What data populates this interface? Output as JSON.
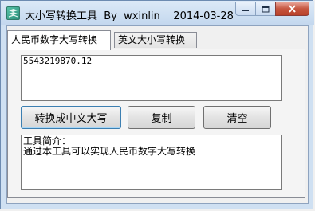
{
  "window": {
    "title": "大小写转换工具  By  wxinlin    2014-03-28",
    "app_icon": "converter-app-icon",
    "controls": {
      "minimize_icon": "minimize-icon",
      "maximize_icon": "maximize-icon",
      "close_icon": "close-icon"
    }
  },
  "tabs": [
    {
      "label": "人民币数字大写转换",
      "active": true
    },
    {
      "label": "英文大小写转换",
      "active": false
    }
  ],
  "input": {
    "value": "5543219870.12"
  },
  "buttons": {
    "convert_label": "转换成中文大写",
    "copy_label": "复制",
    "clear_label": "清空"
  },
  "output": {
    "line1": "工具简介：",
    "line2": "通过本工具可以实现人民币数字大写转换"
  }
}
